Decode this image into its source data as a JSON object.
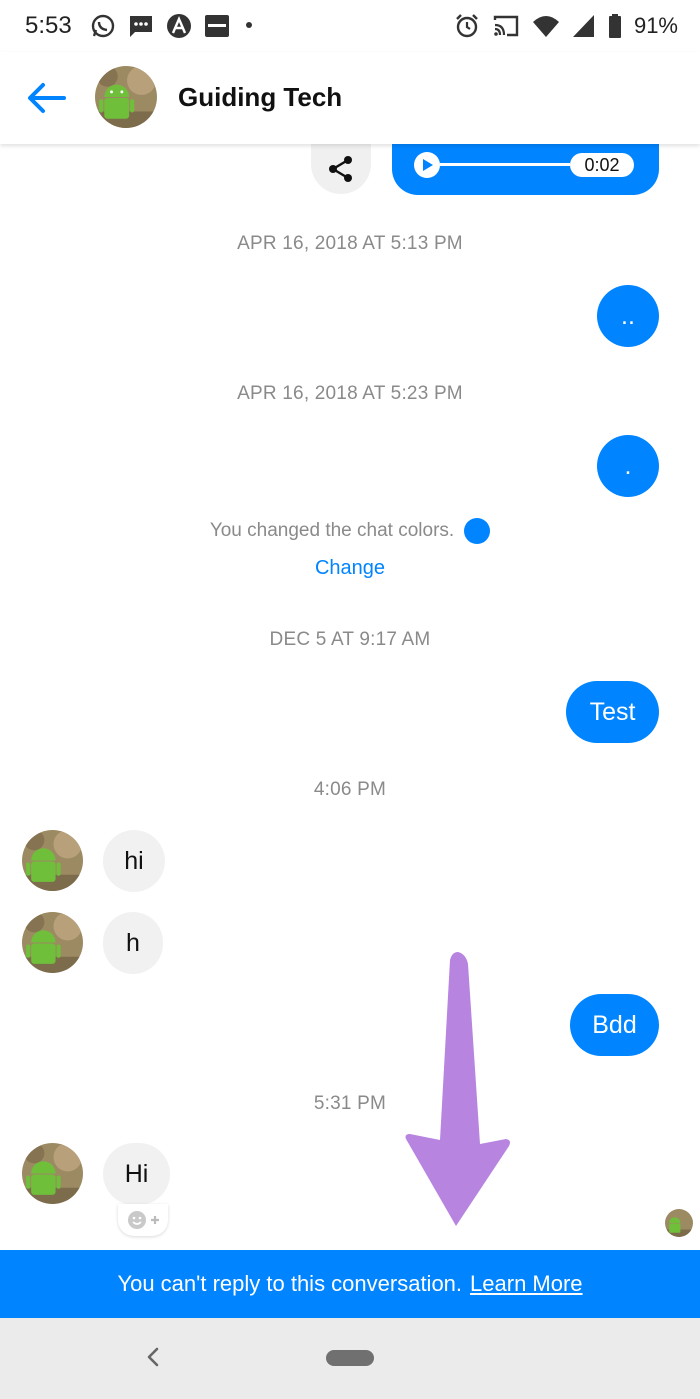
{
  "status_bar": {
    "time": "5:53",
    "battery_percent": "91%",
    "left_icons": [
      "whatsapp-icon",
      "sms-icon",
      "arc-app-icon",
      "paytm-icon",
      "more-notifications-dot-icon"
    ],
    "right_icons": [
      "alarm-icon",
      "cast-icon",
      "wifi-icon",
      "signal-icon",
      "battery-icon"
    ]
  },
  "header": {
    "title": "Guiding Tech"
  },
  "conversation": {
    "audio_message": {
      "duration": "0:02"
    },
    "timestamps": {
      "t1": "APR 16, 2018 AT 5:13 PM",
      "t2": "APR 16, 2018 AT 5:23 PM",
      "t3": "DEC 5 AT 9:17 AM",
      "t4": "4:06 PM",
      "t5": "5:31 PM"
    },
    "messages": {
      "out_1": "..",
      "out_2": ".",
      "out_3": "Test",
      "in_1": "hi",
      "in_2": "h",
      "out_4": "Bdd",
      "in_3": "Hi"
    },
    "system_note": "You changed the chat colors.",
    "change_link": "Change"
  },
  "banner": {
    "text": "You can't reply to this conversation.",
    "link": "Learn More"
  },
  "colors": {
    "accent": "#0084ff",
    "incoming_bubble": "#f1f1f1",
    "annotation_arrow": "#b784e0"
  }
}
